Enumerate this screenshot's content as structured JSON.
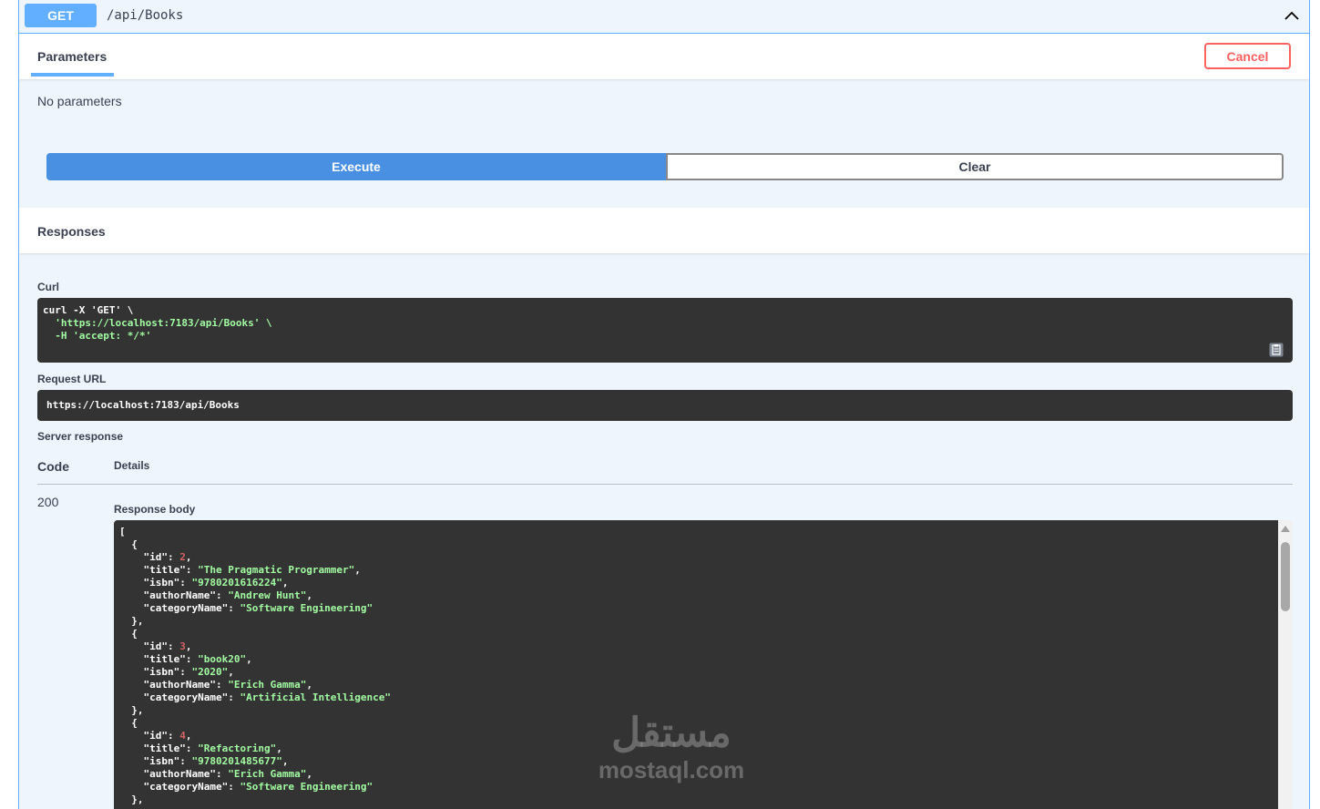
{
  "operation": {
    "method": "GET",
    "path": "/api/Books"
  },
  "parameters": {
    "tab_label": "Parameters",
    "cancel_label": "Cancel",
    "empty_text": "No parameters"
  },
  "actions": {
    "execute_label": "Execute",
    "clear_label": "Clear"
  },
  "responses": {
    "title": "Responses",
    "curl_label": "Curl",
    "curl_lines": [
      "curl -X 'GET' \\",
      "  'https://localhost:7183/api/Books' \\",
      "  -H 'accept: */*'"
    ],
    "request_url_label": "Request URL",
    "request_url": "https://localhost:7183/api/Books",
    "server_response_label": "Server response",
    "code_header": "Code",
    "details_header": "Details",
    "status_code": "200",
    "response_body_label": "Response body",
    "books": [
      {
        "id": 2,
        "title": "The Pragmatic Programmer",
        "isbn": "9780201616224",
        "authorName": "Andrew Hunt",
        "categoryName": "Software Engineering"
      },
      {
        "id": 3,
        "title": "book20",
        "isbn": "2020",
        "authorName": "Erich Gamma",
        "categoryName": "Artificial Intelligence"
      },
      {
        "id": 4,
        "title": "Refactoring",
        "isbn": "9780201485677",
        "authorName": "Erich Gamma",
        "categoryName": "Software Engineering"
      }
    ]
  },
  "watermark": {
    "arabic": "مستقل",
    "latin": "mostaql.com"
  },
  "icons": {
    "collapse": "chevron-up-icon",
    "copy": "copy-to-clipboard-icon"
  },
  "colors": {
    "get_method": "#61affe",
    "execute": "#4990e2",
    "cancel": "#ff6060",
    "code_bg": "#333333",
    "string": "#a2fca2",
    "number": "#d36363"
  }
}
